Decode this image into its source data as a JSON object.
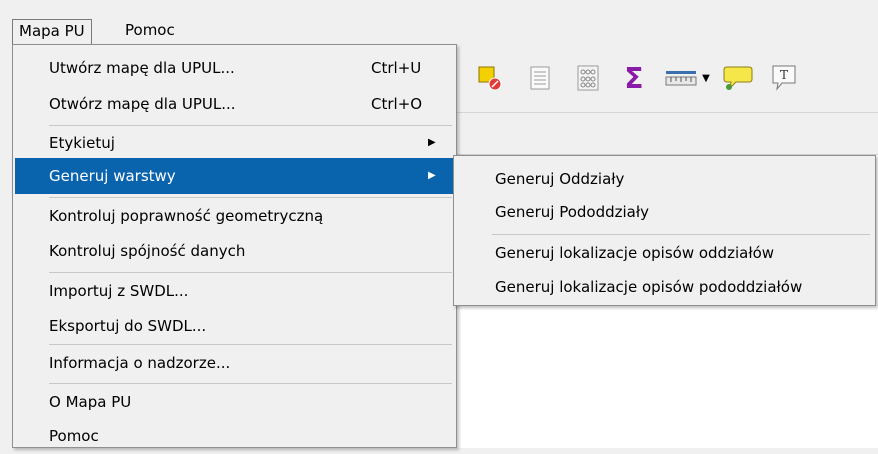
{
  "menubar": {
    "items": [
      {
        "label": "Mapa PU",
        "active": true
      },
      {
        "label": "Pomoc",
        "active": false
      }
    ]
  },
  "menu": {
    "items": [
      {
        "label": "Utwórz mapę dla UPUL...",
        "shortcut": "Ctrl+U"
      },
      {
        "label": "Otwórz mapę dla UPUL...",
        "shortcut": "Ctrl+O"
      },
      {
        "label": "Etykietuj",
        "submenu": true
      },
      {
        "label": "Generuj warstwy",
        "submenu": true,
        "highlighted": true
      },
      {
        "label": "Kontroluj poprawność geometryczną"
      },
      {
        "label": "Kontroluj spójność danych"
      },
      {
        "label": "Importuj z SWDL..."
      },
      {
        "label": "Eksportuj do SWDL..."
      },
      {
        "label": "Informacja o nadzorze..."
      },
      {
        "label": "O Mapa PU"
      },
      {
        "label": "Pomoc"
      }
    ],
    "highlight_color": "#0a64ad"
  },
  "submenu": {
    "items": [
      {
        "label": "Generuj Oddziały"
      },
      {
        "label": "Generuj Pododdziały"
      },
      {
        "label": "Generuj lokalizacje opisów oddziałów"
      },
      {
        "label": "Generuj lokalizacje opisów pododdziałów"
      }
    ]
  },
  "toolbar": {
    "icons": [
      "deselect-features-icon",
      "attribute-table-icon",
      "field-calculator-icon",
      "statistics-sum-icon",
      "measure-icon",
      "map-tips-icon",
      "text-annotation-icon"
    ],
    "sum_symbol": "Σ",
    "text_symbol": "T"
  }
}
